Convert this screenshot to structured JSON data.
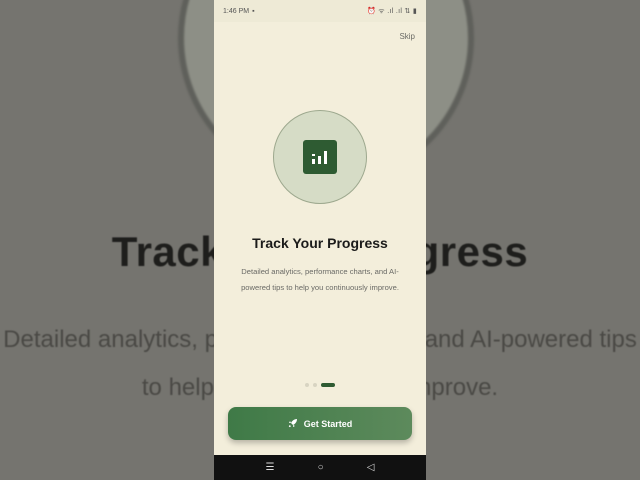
{
  "status_bar": {
    "time": "1:46 PM",
    "indicators": "⏰ ᯤ .ıl .ıl ⇅ ▮"
  },
  "onboarding": {
    "skip_label": "Skip",
    "icon": "chart-bars-icon",
    "title": "Track Your Progress",
    "description": "Detailed analytics, performance charts, and AI-powered tips to help you continuously improve.",
    "page_indicator": {
      "pages": 3,
      "current": 3
    },
    "cta_label": "Get Started",
    "cta_icon": "rocket-icon"
  },
  "background": {
    "title": "Track Your Progress",
    "description": "Detailed analytics, performance charts, and AI-powered tips to help you continuously improve."
  },
  "nav_bar": {
    "menu": "☰",
    "home": "○",
    "back": "◁"
  },
  "colors": {
    "accent": "#2e5b32",
    "screen_bg": "#f3eedb",
    "button": "#4a7f4f"
  }
}
